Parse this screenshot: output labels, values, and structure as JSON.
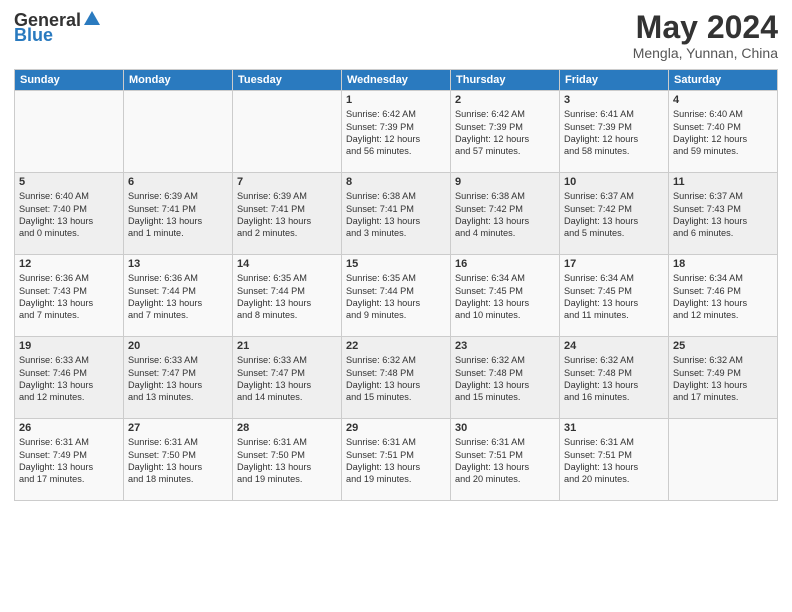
{
  "header": {
    "logo_general": "General",
    "logo_blue": "Blue",
    "month": "May 2024",
    "location": "Mengla, Yunnan, China"
  },
  "days_of_week": [
    "Sunday",
    "Monday",
    "Tuesday",
    "Wednesday",
    "Thursday",
    "Friday",
    "Saturday"
  ],
  "weeks": [
    [
      {
        "day": "",
        "content": ""
      },
      {
        "day": "",
        "content": ""
      },
      {
        "day": "",
        "content": ""
      },
      {
        "day": "1",
        "content": "Sunrise: 6:42 AM\nSunset: 7:39 PM\nDaylight: 12 hours\nand 56 minutes."
      },
      {
        "day": "2",
        "content": "Sunrise: 6:42 AM\nSunset: 7:39 PM\nDaylight: 12 hours\nand 57 minutes."
      },
      {
        "day": "3",
        "content": "Sunrise: 6:41 AM\nSunset: 7:39 PM\nDaylight: 12 hours\nand 58 minutes."
      },
      {
        "day": "4",
        "content": "Sunrise: 6:40 AM\nSunset: 7:40 PM\nDaylight: 12 hours\nand 59 minutes."
      }
    ],
    [
      {
        "day": "5",
        "content": "Sunrise: 6:40 AM\nSunset: 7:40 PM\nDaylight: 13 hours\nand 0 minutes."
      },
      {
        "day": "6",
        "content": "Sunrise: 6:39 AM\nSunset: 7:41 PM\nDaylight: 13 hours\nand 1 minute."
      },
      {
        "day": "7",
        "content": "Sunrise: 6:39 AM\nSunset: 7:41 PM\nDaylight: 13 hours\nand 2 minutes."
      },
      {
        "day": "8",
        "content": "Sunrise: 6:38 AM\nSunset: 7:41 PM\nDaylight: 13 hours\nand 3 minutes."
      },
      {
        "day": "9",
        "content": "Sunrise: 6:38 AM\nSunset: 7:42 PM\nDaylight: 13 hours\nand 4 minutes."
      },
      {
        "day": "10",
        "content": "Sunrise: 6:37 AM\nSunset: 7:42 PM\nDaylight: 13 hours\nand 5 minutes."
      },
      {
        "day": "11",
        "content": "Sunrise: 6:37 AM\nSunset: 7:43 PM\nDaylight: 13 hours\nand 6 minutes."
      }
    ],
    [
      {
        "day": "12",
        "content": "Sunrise: 6:36 AM\nSunset: 7:43 PM\nDaylight: 13 hours\nand 7 minutes."
      },
      {
        "day": "13",
        "content": "Sunrise: 6:36 AM\nSunset: 7:44 PM\nDaylight: 13 hours\nand 7 minutes."
      },
      {
        "day": "14",
        "content": "Sunrise: 6:35 AM\nSunset: 7:44 PM\nDaylight: 13 hours\nand 8 minutes."
      },
      {
        "day": "15",
        "content": "Sunrise: 6:35 AM\nSunset: 7:44 PM\nDaylight: 13 hours\nand 9 minutes."
      },
      {
        "day": "16",
        "content": "Sunrise: 6:34 AM\nSunset: 7:45 PM\nDaylight: 13 hours\nand 10 minutes."
      },
      {
        "day": "17",
        "content": "Sunrise: 6:34 AM\nSunset: 7:45 PM\nDaylight: 13 hours\nand 11 minutes."
      },
      {
        "day": "18",
        "content": "Sunrise: 6:34 AM\nSunset: 7:46 PM\nDaylight: 13 hours\nand 12 minutes."
      }
    ],
    [
      {
        "day": "19",
        "content": "Sunrise: 6:33 AM\nSunset: 7:46 PM\nDaylight: 13 hours\nand 12 minutes."
      },
      {
        "day": "20",
        "content": "Sunrise: 6:33 AM\nSunset: 7:47 PM\nDaylight: 13 hours\nand 13 minutes."
      },
      {
        "day": "21",
        "content": "Sunrise: 6:33 AM\nSunset: 7:47 PM\nDaylight: 13 hours\nand 14 minutes."
      },
      {
        "day": "22",
        "content": "Sunrise: 6:32 AM\nSunset: 7:48 PM\nDaylight: 13 hours\nand 15 minutes."
      },
      {
        "day": "23",
        "content": "Sunrise: 6:32 AM\nSunset: 7:48 PM\nDaylight: 13 hours\nand 15 minutes."
      },
      {
        "day": "24",
        "content": "Sunrise: 6:32 AM\nSunset: 7:48 PM\nDaylight: 13 hours\nand 16 minutes."
      },
      {
        "day": "25",
        "content": "Sunrise: 6:32 AM\nSunset: 7:49 PM\nDaylight: 13 hours\nand 17 minutes."
      }
    ],
    [
      {
        "day": "26",
        "content": "Sunrise: 6:31 AM\nSunset: 7:49 PM\nDaylight: 13 hours\nand 17 minutes."
      },
      {
        "day": "27",
        "content": "Sunrise: 6:31 AM\nSunset: 7:50 PM\nDaylight: 13 hours\nand 18 minutes."
      },
      {
        "day": "28",
        "content": "Sunrise: 6:31 AM\nSunset: 7:50 PM\nDaylight: 13 hours\nand 19 minutes."
      },
      {
        "day": "29",
        "content": "Sunrise: 6:31 AM\nSunset: 7:51 PM\nDaylight: 13 hours\nand 19 minutes."
      },
      {
        "day": "30",
        "content": "Sunrise: 6:31 AM\nSunset: 7:51 PM\nDaylight: 13 hours\nand 20 minutes."
      },
      {
        "day": "31",
        "content": "Sunrise: 6:31 AM\nSunset: 7:51 PM\nDaylight: 13 hours\nand 20 minutes."
      },
      {
        "day": "",
        "content": ""
      }
    ]
  ]
}
